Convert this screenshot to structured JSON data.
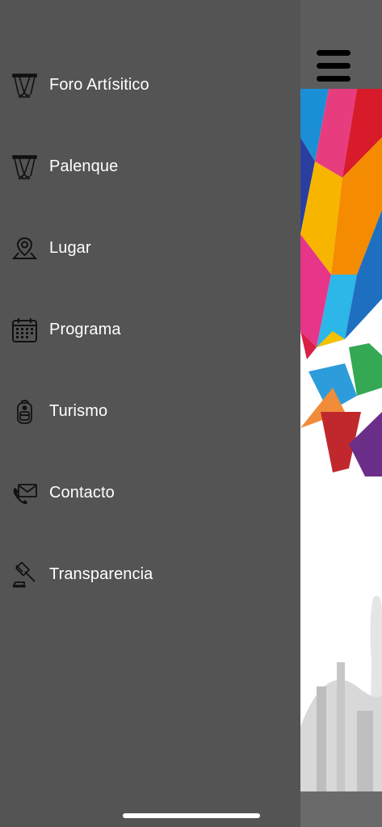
{
  "menu": {
    "items": [
      {
        "label": "Foro Artísitico",
        "icon": "stage-icon"
      },
      {
        "label": "Palenque",
        "icon": "arena-icon"
      },
      {
        "label": "Lugar",
        "icon": "map-pin-icon"
      },
      {
        "label": "Programa",
        "icon": "calendar-icon"
      },
      {
        "label": "Turismo",
        "icon": "backpack-icon"
      },
      {
        "label": "Contacto",
        "icon": "mail-phone-icon"
      },
      {
        "label": "Transparencia",
        "icon": "gavel-icon"
      }
    ]
  },
  "colors": {
    "drawer_background": "#545454",
    "header_background": "#5c5c5c",
    "text": "#ffffff"
  }
}
